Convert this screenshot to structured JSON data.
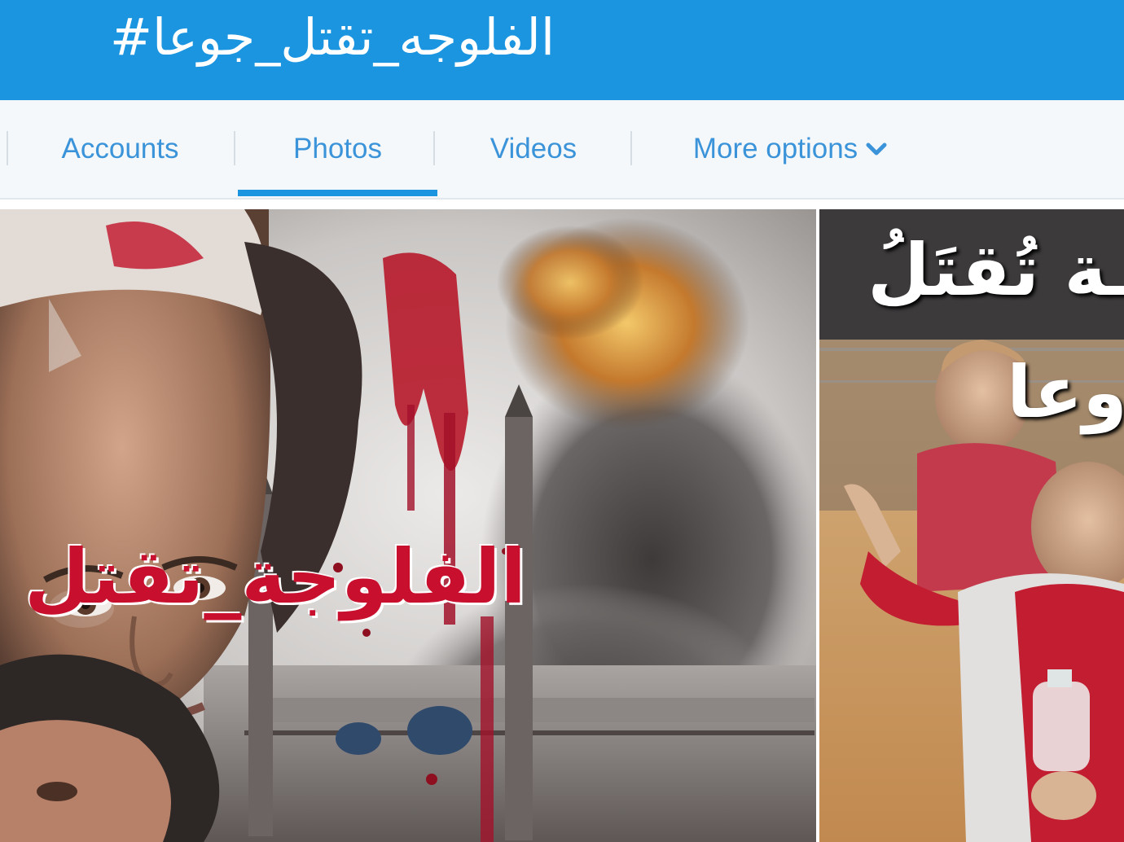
{
  "header": {
    "hashtag": "#الفلوجه_تقتل_جوعا"
  },
  "nav": {
    "tabs": [
      {
        "label": "Accounts",
        "active": false
      },
      {
        "label": "Photos",
        "active": true
      },
      {
        "label": "Videos",
        "active": false
      },
      {
        "label": "More options",
        "active": false,
        "icon": "chevron-down-icon"
      }
    ]
  },
  "photos": [
    {
      "overlay_text": "الفلوجة_تقتل",
      "overlay_color": "#c8102e"
    },
    {
      "overlay_text_top": "ـة تُقتَلُ",
      "overlay_text_bottom": "وعا",
      "overlay_color": "#ffffff"
    }
  ],
  "colors": {
    "brand": "#1b95e0",
    "tab_text": "#3b94d9",
    "nav_bg": "#f5f8fa"
  }
}
